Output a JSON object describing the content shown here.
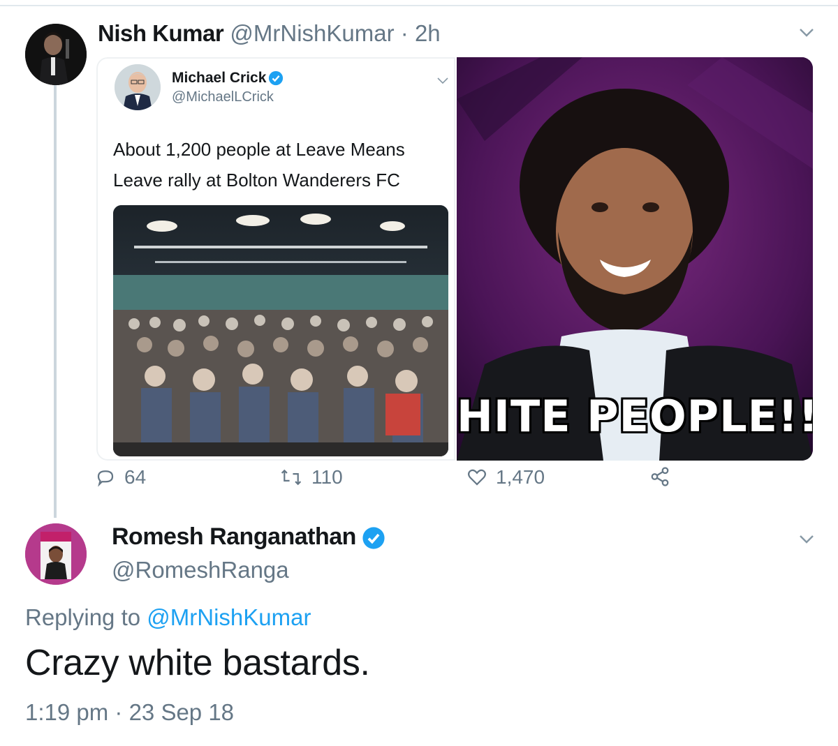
{
  "tweet1": {
    "author_name": "Nish Kumar",
    "handle": "@MrNishKumar",
    "separator": "·",
    "time": "2h",
    "quoted_screenshot": {
      "author_name": "Michael Crick",
      "handle": "@MichaelLCrick",
      "text": "About 1,200 people at Leave Means Leave rally at Bolton Wanderers FC"
    },
    "meme_caption": "HITE PEOPLE!!",
    "actions": {
      "replies": "64",
      "retweets": "110",
      "likes": "1,470"
    }
  },
  "tweet2": {
    "author_name": "Romesh Ranganathan",
    "handle": "@RomeshRanga",
    "replying_prefix": "Replying to",
    "replying_to": "@MrNishKumar",
    "text": "Crazy white bastards.",
    "timestamp": "1:19 pm · 23 Sep 18"
  },
  "colors": {
    "link": "#1da1f2",
    "secondary_text": "#657786",
    "primary_text": "#14171a",
    "thread_line": "#ccd6dd"
  },
  "icons": [
    "reply-icon",
    "retweet-icon",
    "like-icon",
    "share-icon",
    "verified-icon",
    "chevron-down-icon"
  ]
}
